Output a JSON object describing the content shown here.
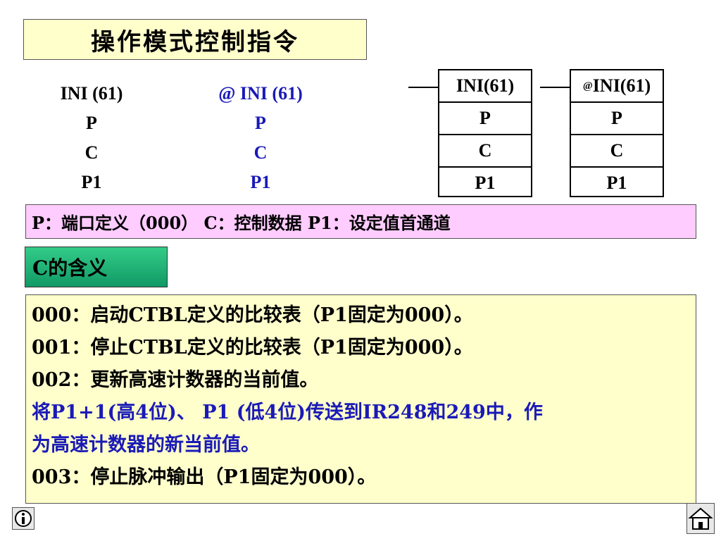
{
  "title": "操作模式控制指令",
  "statements": {
    "plain": {
      "mnemonic": "INI (61)",
      "p": "P",
      "c": "C",
      "p1": "P1"
    },
    "at": {
      "mnemonic": "@ INI (61)",
      "p": "P",
      "c": "C",
      "p1": "P1"
    }
  },
  "ladder": {
    "box1": {
      "header": "INI(61)",
      "p": "P",
      "c": "C",
      "p1": "P1"
    },
    "box2": {
      "prefix": "@",
      "header": "INI(61)",
      "p": "P",
      "c": "C",
      "p1": "P1"
    }
  },
  "definition": "P：端口定义（000）  C：控制数据    P1：设定值首通道",
  "c_meaning_label": "C的含义",
  "meanings": [
    "000：启动CTBL定义的比较表（P1固定为000）。",
    "001：停止CTBL定义的比较表（P1固定为000）。",
    "002：更新高速计数器的当前值。",
    "将P1+1(高4位)、 P1 (低4位)传送到IR248和249中，作",
    "为高速计数器的新当前值。",
    "003：停止脉冲输出（P1固定为000）。"
  ],
  "colors": {
    "blue_text": "#1a1ab8",
    "title_bg": "#ffffcc",
    "def_bg": "#ffccff",
    "c_bg": "#22aa77"
  },
  "icons": {
    "info": "info-icon",
    "home": "home-icon"
  }
}
